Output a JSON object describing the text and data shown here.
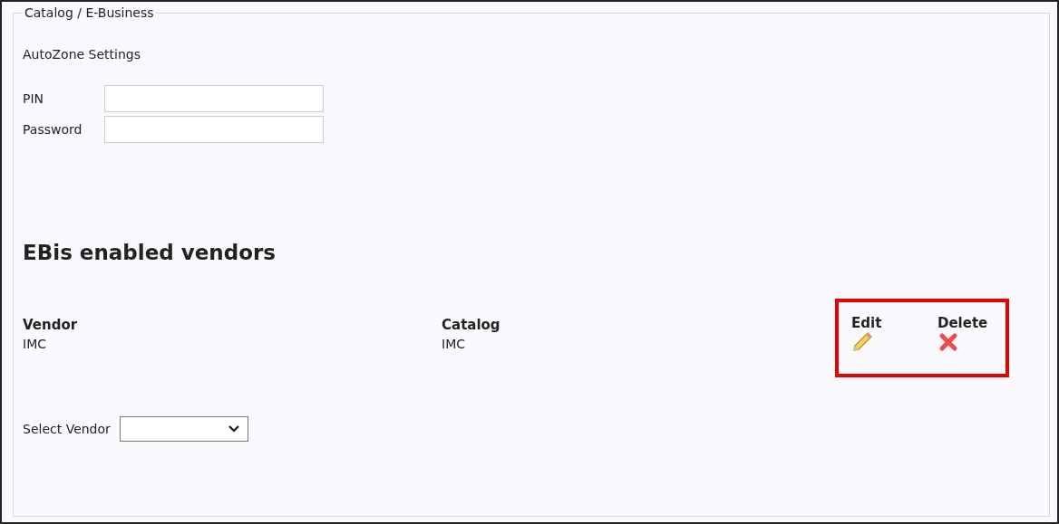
{
  "fieldset": {
    "legend": "Catalog / E-Business"
  },
  "settings": {
    "title": "AutoZone Settings",
    "fields": [
      {
        "label": "PIN"
      },
      {
        "label": "Password"
      }
    ]
  },
  "vendors": {
    "heading": "EBis enabled vendors",
    "actions_highlighted": true,
    "columns": [
      "Vendor",
      "Catalog",
      "Edit",
      "Delete"
    ],
    "rows": [
      {
        "vendor": "IMC",
        "catalog": "IMC"
      }
    ]
  },
  "select_vendor": {
    "label": "Select Vendor"
  }
}
